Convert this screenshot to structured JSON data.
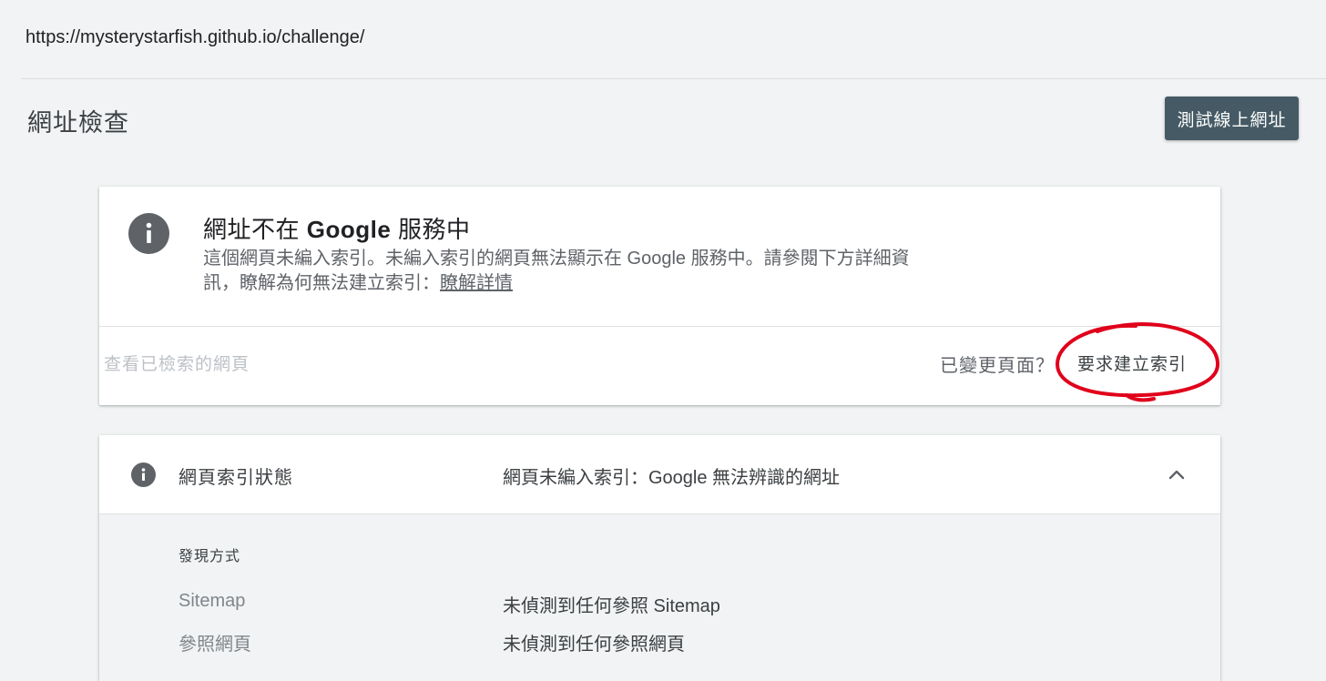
{
  "url_bar": {
    "url": "https://mysterystarfish.github.io/challenge/"
  },
  "header": {
    "title": "網址檢查",
    "test_live_button": "測試線上網址"
  },
  "status_card": {
    "icon": "info-icon",
    "title_prefix": "網址不在 ",
    "title_brand": "Google",
    "title_suffix": " 服務中",
    "description": "這個網頁未編入索引。未編入索引的網頁無法顯示在 Google 服務中。請參閱下方詳細資訊，瞭解為何無法建立索引：",
    "learn_more_link": "瞭解詳情",
    "view_crawled_page": "查看已檢索的網頁",
    "page_changed_label": "已變更頁面？",
    "request_indexing": "要求建立索引",
    "annotation_color": "#e0001b"
  },
  "index_card": {
    "icon": "info-icon",
    "label": "網頁索引狀態",
    "value": "網頁未編入索引：Google 無法辨識的網址",
    "chevron": "chevron-up-icon",
    "discovery": {
      "heading": "發現方式",
      "rows": [
        {
          "label": "Sitemap",
          "value": "未偵測到任何參照 Sitemap"
        },
        {
          "label": "參照網頁",
          "value": "未偵測到任何參照網頁"
        }
      ]
    }
  },
  "colors": {
    "background": "#f1f3f4",
    "button_bg": "#455a64",
    "icon_gray": "#5f6368"
  }
}
